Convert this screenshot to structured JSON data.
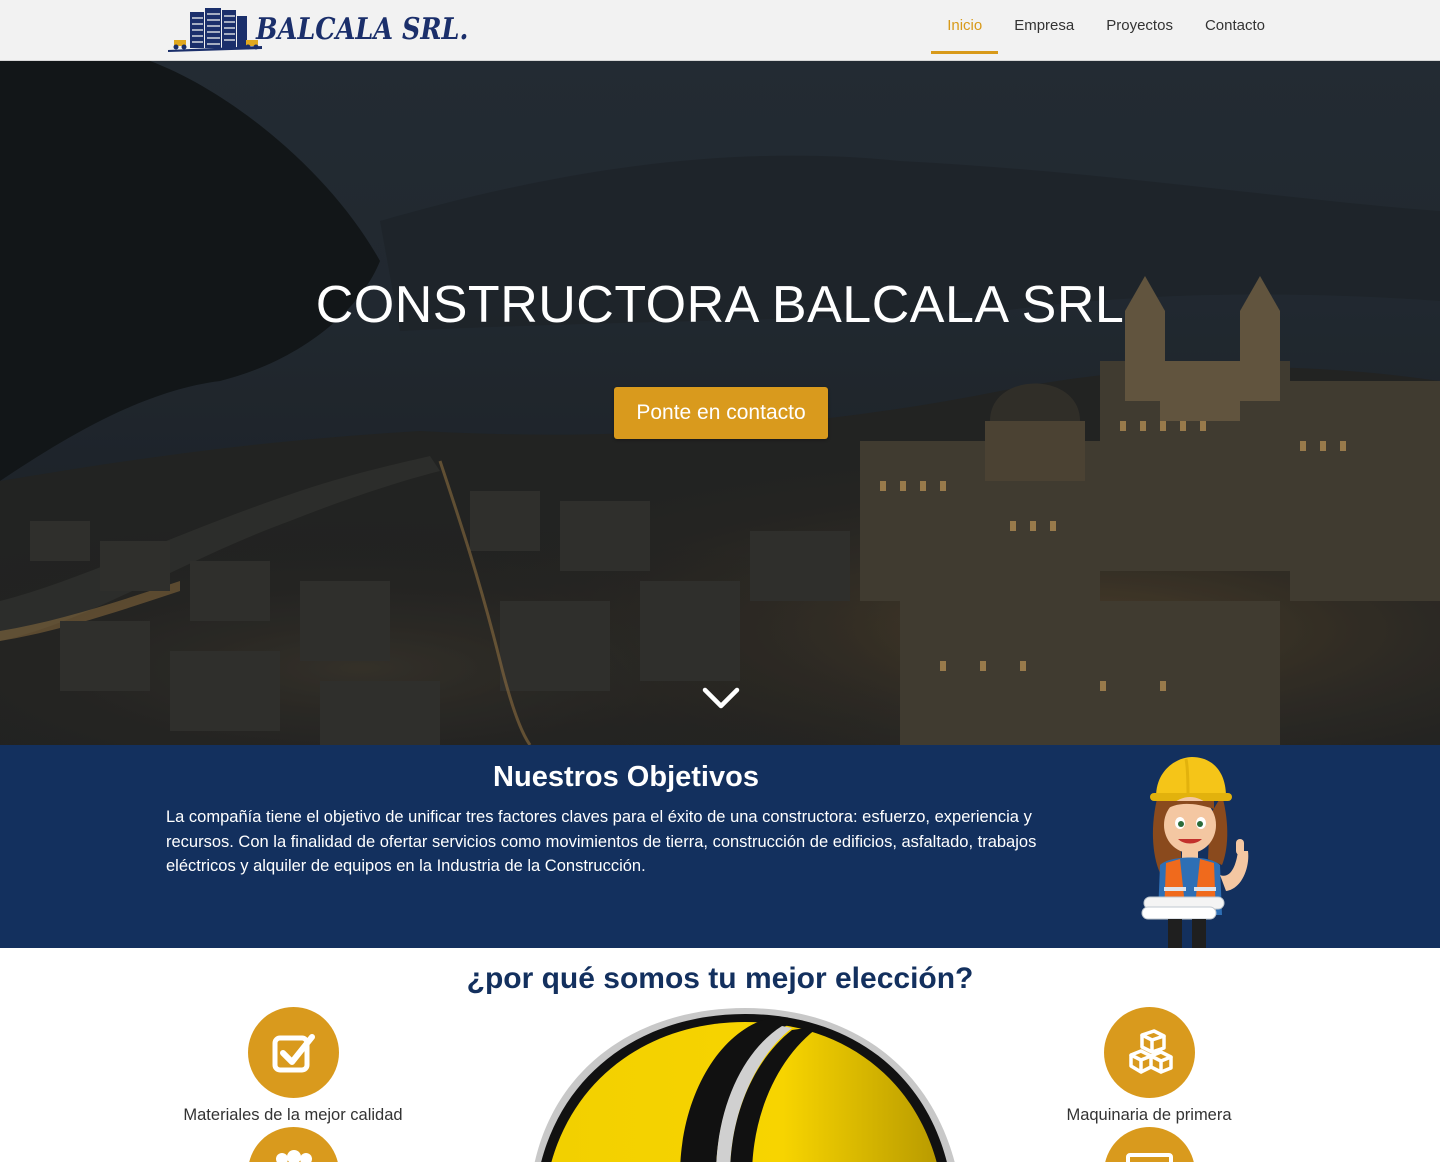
{
  "brand": {
    "name": "BALCALA SRL.",
    "logo_icon": "building-logo-icon",
    "colors": {
      "navy": "#13305e",
      "gold": "#d99a1d"
    }
  },
  "nav": {
    "items": [
      {
        "label": "Inicio",
        "active": true
      },
      {
        "label": "Empresa",
        "active": false
      },
      {
        "label": "Proyectos",
        "active": false
      },
      {
        "label": "Contacto",
        "active": false
      }
    ]
  },
  "hero": {
    "title": "CONSTRUCTORA BALCALA SRL",
    "cta_label": "Ponte en contacto",
    "scroll_icon": "chevron-down-icon"
  },
  "objectives": {
    "title": "Nuestros Objetivos",
    "text": "La compañía tiene el objetivo de unificar tres factores claves para el éxito de una constructora: esfuerzo, experiencia y recursos. Con la finalidad de ofertar servicios como movimientos de tierra, construcción de edificios, asfaltado, trabajos eléctricos y alquiler de equipos en la Industria de la Construcción."
  },
  "why": {
    "title": "¿por qué somos tu mejor elección?",
    "features": [
      {
        "label": "Materiales de la mejor calidad",
        "icon": "checkbox-icon"
      },
      {
        "label": "Maquinaria de primera",
        "icon": "cubes-icon"
      },
      {
        "label": "",
        "icon": "users-icon"
      },
      {
        "label": "",
        "icon": "money-icon"
      }
    ]
  }
}
